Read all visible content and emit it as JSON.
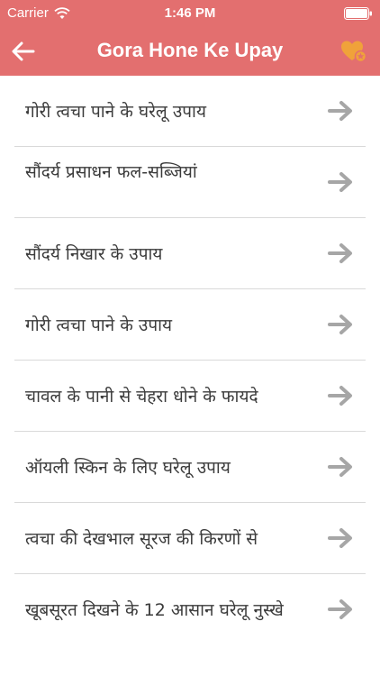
{
  "status_bar": {
    "carrier": "Carrier",
    "time": "1:46 PM",
    "icons": [
      "wifi-icon",
      "battery-icon"
    ]
  },
  "nav": {
    "title": "Gora Hone Ke Upay",
    "back_icon": "back-arrow-icon",
    "favorite_icon": "heart-star-icon"
  },
  "colors": {
    "accent": "#e36f6f",
    "favorite_icon": "#f0a23a",
    "text": "#3b3b3b",
    "arrow": "#a6a6a6",
    "divider": "#d9d9d9"
  },
  "items": [
    {
      "label": "गोरी त्वचा पाने के घरेलू उपाय"
    },
    {
      "label": "सौंदर्य प्रसाधन फल-सब्जियां"
    },
    {
      "label": "सौंदर्य निखार के उपाय"
    },
    {
      "label": "गोरी त्वचा पाने के उपाय"
    },
    {
      "label": "चावल के पानी से चेहरा धोने के फायदे"
    },
    {
      "label": "ऑयली स्किन के लिए घरेलू उपाय"
    },
    {
      "label": "त्वचा की देखभाल सूरज की किरणों से"
    },
    {
      "label": "खूबसूरत दिखने के 12 आसान घरेलू नुस्खे"
    }
  ]
}
